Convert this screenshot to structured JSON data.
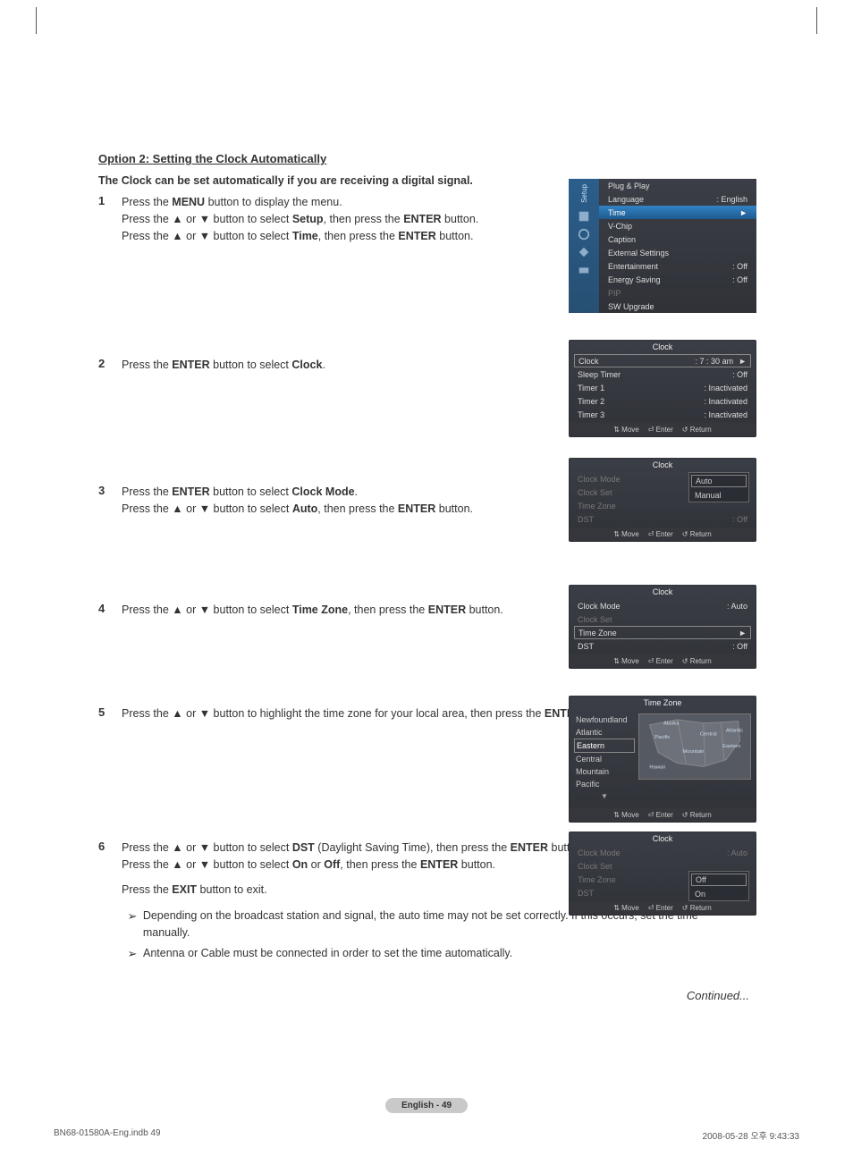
{
  "title": "Option 2: Setting the Clock Automatically",
  "intro": "The Clock can be set automatically if you are receiving a digital signal.",
  "steps": {
    "s1": {
      "n": "1",
      "lines": [
        "Press the <b>MENU</b> button to display the menu.",
        "Press the ▲ or ▼ button to select <b>Setup</b>, then press the <b>ENTER</b> button.",
        "Press the ▲ or ▼ button to select <b>Time</b>, then press the <b>ENTER</b> button."
      ]
    },
    "s2": {
      "n": "2",
      "text": "Press the <b>ENTER</b> button to select <b>Clock</b>."
    },
    "s3": {
      "n": "3",
      "lines": [
        "Press the <b>ENTER</b> button to select <b>Clock Mode</b>.",
        "Press the ▲ or ▼ button to select <b>Auto</b>, then press the <b>ENTER</b> button."
      ]
    },
    "s4": {
      "n": "4",
      "text": "Press the ▲ or ▼ button to select <b>Time Zone</b>, then press the <b>ENTER</b> button."
    },
    "s5": {
      "n": "5",
      "text": "Press the ▲ or ▼ button to highlight the time zone for your local area, then press the <b>ENTER</b> button."
    },
    "s6": {
      "n": "6",
      "lines": [
        "Press the ▲ or ▼ button to select <b>DST</b> (Daylight Saving Time), then press the <b>ENTER</b> button.",
        "Press the ▲ or ▼ button to select <b>On</b> or <b>Off</b>, then press the <b>ENTER</b> button."
      ],
      "extra": "Press the <b>EXIT</b> button to exit."
    }
  },
  "notes": [
    "Depending on the broadcast station and signal, the auto time may not be set correctly. If this occurs, set the time manually.",
    "Antenna or Cable must be connected in order to set the time automatically."
  ],
  "continued": "Continued...",
  "page_label": "English - 49",
  "doc_foot_left": "BN68-01580A-Eng.indb   49",
  "doc_foot_right": "2008-05-28   오후 9:43:33",
  "osd": {
    "setup": {
      "tab_label": "Setup",
      "items": {
        "plug": "Plug & Play",
        "lang_k": "Language",
        "lang_v": ": English",
        "time": "Time",
        "vchip": "V-Chip",
        "caption": "Caption",
        "ext": "External Settings",
        "ent_k": "Entertainment",
        "ent_v": ": Off",
        "energy_k": "Energy Saving",
        "energy_v": ": Off",
        "pip": "PIP",
        "sw": "SW Upgrade"
      }
    },
    "clock1": {
      "title": "Clock",
      "rows": {
        "clock_k": "Clock",
        "clock_v": ":  7 : 30 am",
        "sleep_k": "Sleep Timer",
        "sleep_v": ": Off",
        "t1_k": "Timer 1",
        "t1_v": ": Inactivated",
        "t2_k": "Timer 2",
        "t2_v": ": Inactivated",
        "t3_k": "Timer 3",
        "t3_v": ": Inactivated"
      }
    },
    "clock2": {
      "title": "Clock",
      "rows": {
        "mode_k": "Clock Mode",
        "set_k": "Clock Set",
        "tz_k": "Time Zone",
        "dst_k": "DST",
        "dst_v": ": Off"
      },
      "dropdown": {
        "auto": "Auto",
        "manual": "Manual"
      }
    },
    "clock3": {
      "title": "Clock",
      "rows": {
        "mode_k": "Clock Mode",
        "mode_v": ": Auto",
        "set_k": "Clock Set",
        "tz_k": "Time Zone",
        "dst_k": "DST",
        "dst_v": ": Off"
      }
    },
    "tz": {
      "title": "Time Zone",
      "list": [
        "Newfoundland",
        "Atlantic",
        "Eastern",
        "Central",
        "Mountain",
        "Pacific"
      ],
      "sel_index": 2
    },
    "clock4": {
      "title": "Clock",
      "rows": {
        "mode_k": "Clock Mode",
        "mode_v": ": Auto",
        "set_k": "Clock Set",
        "tz_k": "Time Zone",
        "dst_k": "DST"
      },
      "dropdown": {
        "off": "Off",
        "on": "On"
      }
    },
    "foot": {
      "move": "Move",
      "enter": "Enter",
      "return": "Return"
    }
  }
}
